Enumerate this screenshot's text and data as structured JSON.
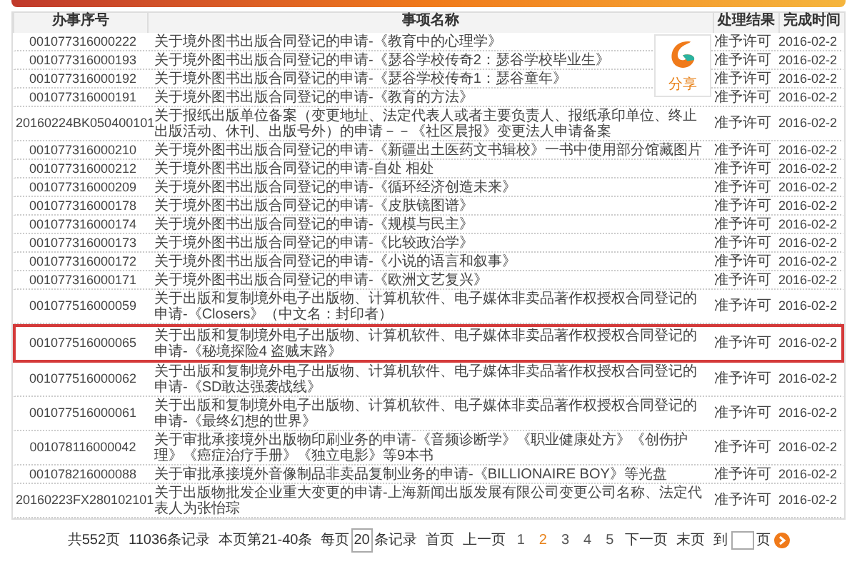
{
  "columns": [
    "办事序号",
    "事项名称",
    "处理结果",
    "完成时间"
  ],
  "rows": [
    {
      "id": "001077316000222",
      "name": "关于境外图书出版合同登记的申请-《教育中的心理学》",
      "result": "准予许可",
      "date": "2016-02-2",
      "highlighted": false
    },
    {
      "id": "001077316000193",
      "name": "关于境外图书出版合同登记的申请-《瑟谷学校传奇2：瑟谷学校毕业生》",
      "result": "准予许可",
      "date": "2016-02-2",
      "highlighted": false
    },
    {
      "id": "001077316000192",
      "name": "关于境外图书出版合同登记的申请-《瑟谷学校传奇1：瑟谷童年》",
      "result": "准予许可",
      "date": "2016-02-2",
      "highlighted": false
    },
    {
      "id": "001077316000191",
      "name": "关于境外图书出版合同登记的申请-《教育的方法》",
      "result": "准予许可",
      "date": "2016-02-2",
      "highlighted": false
    },
    {
      "id": "20160224BK050400101",
      "name": "关于报纸出版单位备案（变更地址、法定代表人或者主要负责人、报纸承印单位、终止出版活动、休刊、出版号外）的申请－－《社区晨报》变更法人申请备案",
      "result": "准予许可",
      "date": "2016-02-2",
      "highlighted": false
    },
    {
      "id": "001077316000210",
      "name": "关于境外图书出版合同登记的申请-《新疆出土医药文书辑校》一书中使用部分馆藏图片",
      "result": "准予许可",
      "date": "2016-02-2",
      "highlighted": false
    },
    {
      "id": "001077316000212",
      "name": "关于境外图书出版合同登记的申请-自处 相处",
      "result": "准予许可",
      "date": "2016-02-2",
      "highlighted": false
    },
    {
      "id": "001077316000209",
      "name": "关于境外图书出版合同登记的申请-《循环经济创造未来》",
      "result": "准予许可",
      "date": "2016-02-2",
      "highlighted": false
    },
    {
      "id": "001077316000178",
      "name": "关于境外图书出版合同登记的申请-《皮肤镜图谱》",
      "result": "准予许可",
      "date": "2016-02-2",
      "highlighted": false
    },
    {
      "id": "001077316000174",
      "name": "关于境外图书出版合同登记的申请-《规模与民主》",
      "result": "准予许可",
      "date": "2016-02-2",
      "highlighted": false
    },
    {
      "id": "001077316000173",
      "name": "关于境外图书出版合同登记的申请-《比较政治学》",
      "result": "准予许可",
      "date": "2016-02-2",
      "highlighted": false
    },
    {
      "id": "001077316000172",
      "name": "关于境外图书出版合同登记的申请-《小说的语言和叙事》",
      "result": "准予许可",
      "date": "2016-02-2",
      "highlighted": false
    },
    {
      "id": "001077316000171",
      "name": "关于境外图书出版合同登记的申请-《欧洲文艺复兴》",
      "result": "准予许可",
      "date": "2016-02-2",
      "highlighted": false
    },
    {
      "id": "001077516000059",
      "name": "关于出版和复制境外电子出版物、计算机软件、电子媒体非卖品著作权授权合同登记的申请-《Closers》（中文名：封印者）",
      "result": "准予许可",
      "date": "2016-02-2",
      "highlighted": false
    },
    {
      "id": "001077516000065",
      "name": "关于出版和复制境外电子出版物、计算机软件、电子媒体非卖品著作权授权合同登记的申请-《秘境探险4 盗贼末路》",
      "result": "准予许可",
      "date": "2016-02-2",
      "highlighted": true
    },
    {
      "id": "001077516000062",
      "name": "关于出版和复制境外电子出版物、计算机软件、电子媒体非卖品著作权授权合同登记的申请-《SD敢达强袭战线》",
      "result": "准予许可",
      "date": "2016-02-2",
      "highlighted": false
    },
    {
      "id": "001077516000061",
      "name": "关于出版和复制境外电子出版物、计算机软件、电子媒体非卖品著作权授权合同登记的申请-《最终幻想的世界》",
      "result": "准予许可",
      "date": "2016-02-2",
      "highlighted": false
    },
    {
      "id": "001078116000042",
      "name": "关于审批承接境外出版物印刷业务的申请-《音频诊断学》《职业健康处方》《创伤护理》《癌症治疗手册》《独立电影》等9本书",
      "result": "准予许可",
      "date": "2016-02-2",
      "highlighted": false
    },
    {
      "id": "001078216000088",
      "name": "关于审批承接境外音像制品非卖品复制业务的申请-《BILLIONAIRE BOY》等光盘",
      "result": "准予许可",
      "date": "2016-02-2",
      "highlighted": false
    },
    {
      "id": "20160223FX280102101",
      "name": "关于出版物批发企业重大变更的申请-上海新闻出版发展有限公司变更公司名称、法定代表人为张怡琮",
      "result": "准予许可",
      "date": "2016-02-2",
      "highlighted": false
    }
  ],
  "share": {
    "label": "分享"
  },
  "pagination": {
    "total_pages": "共552页",
    "total_records": "11036条记录",
    "range": "本页第21-40条",
    "per_page_prefix": "每页",
    "per_page": "20",
    "per_page_suffix": "条记录",
    "first": "首页",
    "prev": "上一页",
    "pages": [
      {
        "label": "1",
        "selected": false
      },
      {
        "label": "2",
        "selected": true
      },
      {
        "label": "3",
        "selected": false
      },
      {
        "label": "4",
        "selected": false
      },
      {
        "label": "5",
        "selected": false
      }
    ],
    "next": "下一页",
    "last": "末页",
    "goto_prefix": "到",
    "goto_suffix": "页"
  }
}
